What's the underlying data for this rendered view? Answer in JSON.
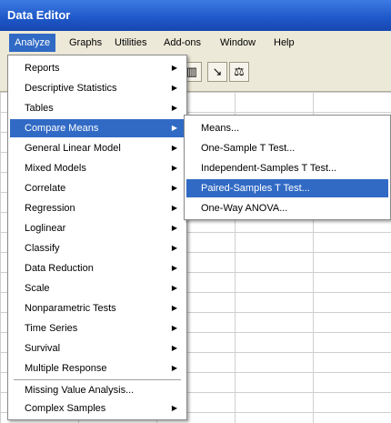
{
  "window": {
    "title": "Data Editor"
  },
  "menubar": {
    "items": [
      "Analyze",
      "Graphs",
      "Utilities",
      "Add-ons",
      "Window",
      "Help"
    ]
  },
  "toolbar": {
    "icons": [
      "bar-chart-icon",
      "pointer-icon",
      "scales-icon"
    ]
  },
  "analyze_menu": {
    "items": [
      "Reports",
      "Descriptive Statistics",
      "Tables",
      "Compare Means",
      "General Linear Model",
      "Mixed Models",
      "Correlate",
      "Regression",
      "Loglinear",
      "Classify",
      "Data Reduction",
      "Scale",
      "Nonparametric Tests",
      "Time Series",
      "Survival",
      "Multiple Response",
      "Missing Value Analysis...",
      "Complex Samples"
    ],
    "selected": "Compare Means"
  },
  "compare_means_menu": {
    "items": [
      "Means...",
      "One-Sample T Test...",
      "Independent-Samples T Test...",
      "Paired-Samples T Test...",
      "One-Way ANOVA..."
    ],
    "selected": "Paired-Samples T Test..."
  },
  "colors": {
    "selection": "#316ac5",
    "titlebar": "#1e57c8"
  }
}
